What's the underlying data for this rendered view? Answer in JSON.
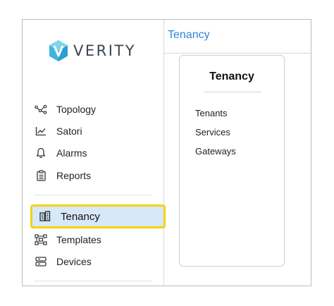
{
  "brand": {
    "name": "VERITY",
    "logo_mark": "V",
    "logo_color_light": "#6fd0e8",
    "logo_color_dark": "#1f8fbf"
  },
  "header": {
    "title": "Tenancy",
    "title_color": "#2f86d6"
  },
  "sidebar": {
    "items": [
      {
        "label": "Topology",
        "icon": "topology-icon"
      },
      {
        "label": "Satori",
        "icon": "chart-line-icon"
      },
      {
        "label": "Alarms",
        "icon": "bell-icon"
      },
      {
        "label": "Reports",
        "icon": "clipboard-icon"
      },
      {
        "label": "Tenancy",
        "icon": "tenancy-icon",
        "selected": true
      },
      {
        "label": "Templates",
        "icon": "templates-icon"
      },
      {
        "label": "Devices",
        "icon": "devices-icon"
      }
    ],
    "selected_bg": "#d7e9f8",
    "highlight_color": "#f4d20a"
  },
  "panel": {
    "title": "Tenancy",
    "links": [
      "Tenants",
      "Services",
      "Gateways"
    ]
  }
}
